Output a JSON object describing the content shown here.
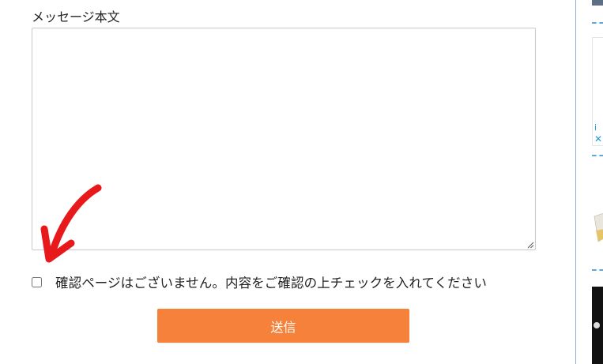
{
  "form": {
    "message_label": "メッセージ本文",
    "message_value": "",
    "confirm_text": "確認ページはございません。内容をご確認の上チェックを入れてください",
    "confirm_checked": false,
    "submit_label": "送信"
  },
  "sidebar": {
    "ad_info_icon": "i",
    "ad_close_icon": "✕"
  },
  "colors": {
    "submit_bg": "#f5813a",
    "arrow": "#e8191a",
    "sidebar_dash": "#5ea8dc",
    "sidebar_border": "#8aaedc"
  },
  "icons": {
    "arrow": "red-curved-arrow-icon",
    "resize": "resize-grip-icon"
  }
}
